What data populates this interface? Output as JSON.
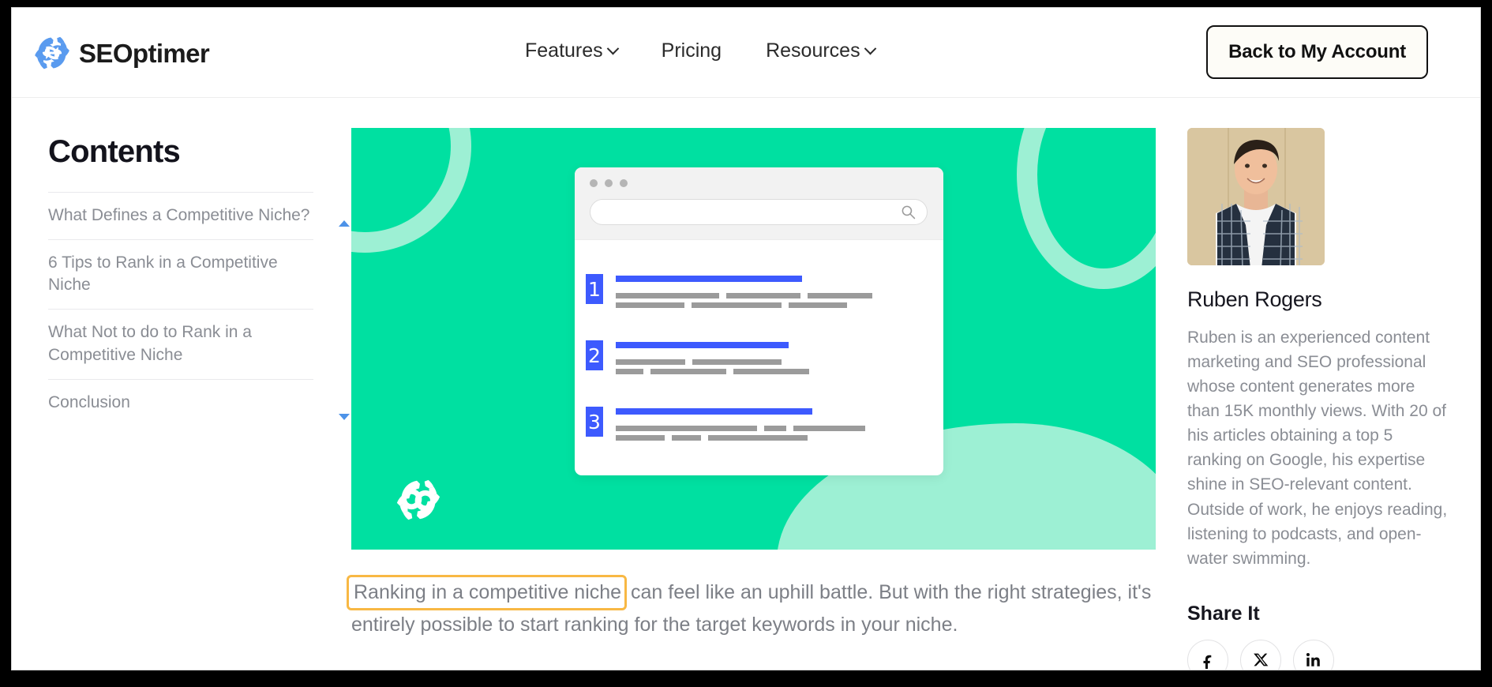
{
  "header": {
    "logo": {
      "icon": "seoptimer-gear-logo",
      "wordmark": "SEOptimer"
    },
    "nav": [
      {
        "label": "Features",
        "has_dropdown": true,
        "icon": "chevron-down-icon"
      },
      {
        "label": "Pricing",
        "has_dropdown": false
      },
      {
        "label": "Resources",
        "has_dropdown": true,
        "icon": "chevron-down-icon"
      }
    ],
    "account_button": "Back to My Account"
  },
  "sidebar": {
    "title": "Contents",
    "scroll_up_icon": "triangle-up-icon",
    "scroll_down_icon": "triangle-down-icon",
    "items": [
      {
        "label": "What Defines a Competitive Niche?"
      },
      {
        "label": "6 Tips to Rank in a Competitive Niche"
      },
      {
        "label": "What Not to do to Rank in a Competitive Niche"
      },
      {
        "label": "Conclusion"
      }
    ]
  },
  "hero": {
    "alt": "search-results-illustration",
    "background_color": "#00e0a1",
    "accent_color": "#9df0d4",
    "logo_icon": "seoptimer-gear-logo-white",
    "browser": {
      "window_dots": 3,
      "search_placeholder": "",
      "search_icon": "magnifier-icon",
      "results": [
        {
          "rank": "1"
        },
        {
          "rank": "2"
        },
        {
          "rank": "3"
        }
      ]
    }
  },
  "article": {
    "highlighted_phrase": "Ranking in a competitive niche",
    "paragraph_rest": " can feel like an uphill battle. But with the right strategies, it's entirely possible to start ranking for the target keywords in your niche.",
    "highlight_color": "#f8b844"
  },
  "author": {
    "photo_alt": "author-portrait-ruben-rogers",
    "name": "Ruben Rogers",
    "bio": "Ruben is an experienced content marketing and SEO professional whose content generates more than 15K monthly views. With 20 of his articles obtaining a top 5 ranking on Google, his expertise shine in SEO-relevant content. Outside of work, he enjoys reading, listening to podcasts, and open-water swimming.",
    "share_title": "Share It",
    "share_links": [
      {
        "name": "facebook",
        "glyph": "f"
      },
      {
        "name": "x-twitter",
        "glyph": "X"
      },
      {
        "name": "linkedin",
        "glyph": "in"
      }
    ]
  },
  "colors": {
    "brand_blue": "#3d5afe",
    "logo_blue": "#5a9bef",
    "hero_green": "#00e0a1",
    "hero_mint": "#9df0d4",
    "highlight_orange": "#f8b844",
    "text_muted": "#8a8d94"
  }
}
